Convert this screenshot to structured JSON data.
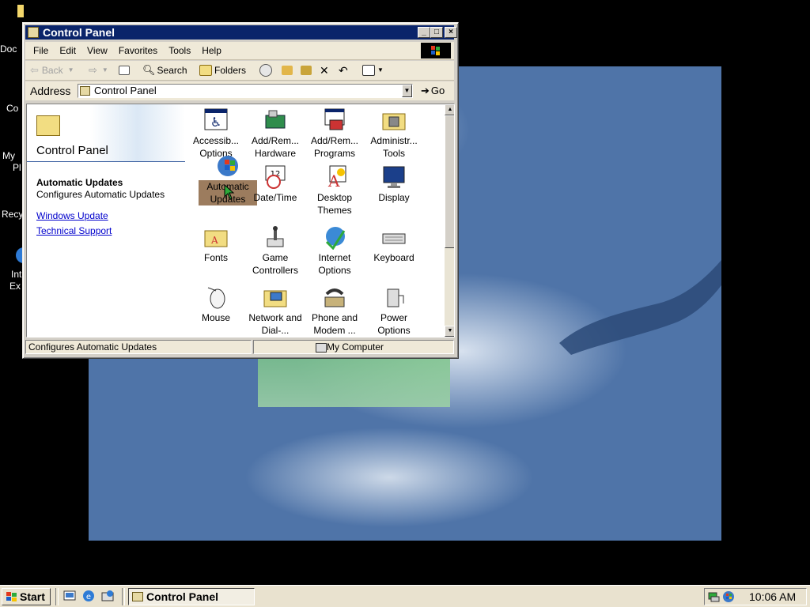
{
  "desktop": {
    "icons": [
      {
        "label": "Doc"
      },
      {
        "label": "Co"
      },
      {
        "label": "My"
      },
      {
        "label": "Pl"
      },
      {
        "label": "Recy"
      },
      {
        "label": "Int"
      },
      {
        "label": "Ex"
      }
    ]
  },
  "window": {
    "title": "Control Panel",
    "menu": [
      "File",
      "Edit",
      "View",
      "Favorites",
      "Tools",
      "Help"
    ],
    "toolbar": {
      "back": "Back",
      "search": "Search",
      "folders": "Folders"
    },
    "address": {
      "label": "Address",
      "value": "Control Panel",
      "go": "Go"
    },
    "left_pane": {
      "title": "Control Panel",
      "selected_title": "Automatic Updates",
      "selected_desc": "Configures Automatic Updates",
      "links": [
        "Windows Update",
        "Technical Support"
      ]
    },
    "items": [
      {
        "label": "Accessib... Options",
        "icon": "accessibility-icon"
      },
      {
        "label": "Add/Rem... Hardware",
        "icon": "add-hardware-icon"
      },
      {
        "label": "Add/Rem... Programs",
        "icon": "add-programs-icon"
      },
      {
        "label": "Administr... Tools",
        "icon": "admin-tools-icon"
      },
      {
        "label": "Automatic Updates",
        "icon": "automatic-updates-icon",
        "selected": true
      },
      {
        "label": "Date/Time",
        "icon": "date-time-icon"
      },
      {
        "label": "Desktop Themes",
        "icon": "desktop-themes-icon"
      },
      {
        "label": "Display",
        "icon": "display-icon"
      },
      {
        "label": "Fonts",
        "icon": "fonts-icon"
      },
      {
        "label": "Game Controllers",
        "icon": "game-controllers-icon"
      },
      {
        "label": "Internet Options",
        "icon": "internet-options-icon"
      },
      {
        "label": "Keyboard",
        "icon": "keyboard-icon"
      },
      {
        "label": "Mouse",
        "icon": "mouse-icon"
      },
      {
        "label": "Network and Dial-...",
        "icon": "network-icon"
      },
      {
        "label": "Phone and Modem ...",
        "icon": "phone-modem-icon"
      },
      {
        "label": "Power Options",
        "icon": "power-options-icon"
      }
    ],
    "status": {
      "left": "Configures Automatic Updates",
      "zone": "My Computer"
    }
  },
  "taskbar": {
    "start": "Start",
    "task": "Control Panel",
    "clock": "10:06 AM"
  }
}
